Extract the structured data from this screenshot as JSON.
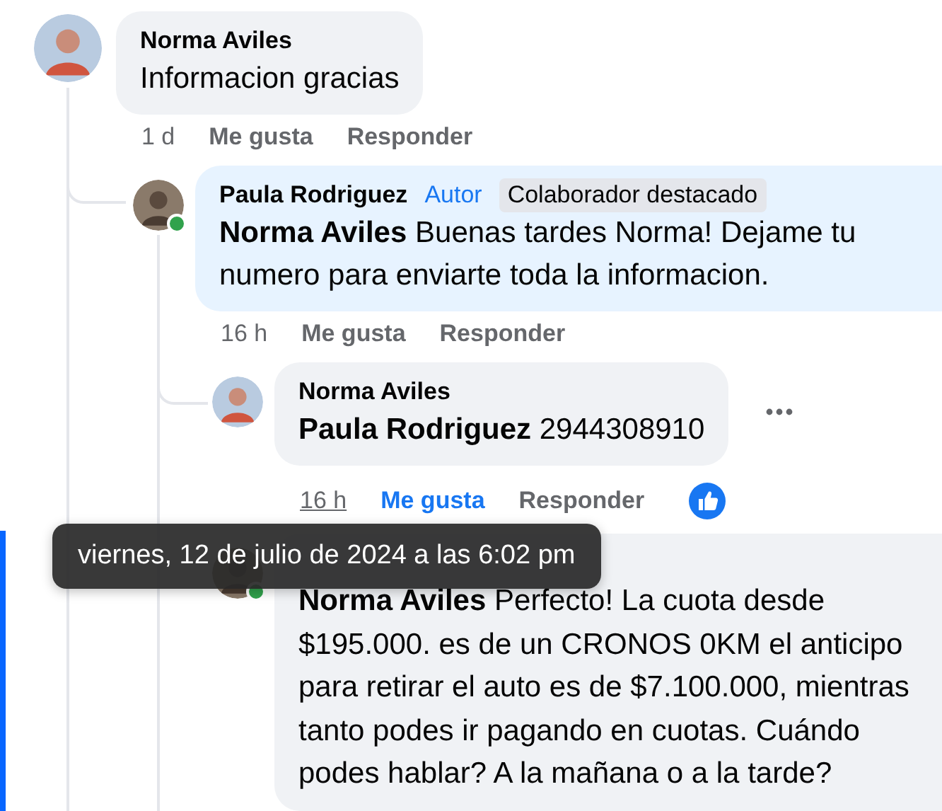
{
  "comments": [
    {
      "author": "Norma Aviles",
      "text": "Informacion gracias",
      "online": false,
      "highlighted": false,
      "time": "1 d",
      "like_label": "Me gusta",
      "reply_label": "Responder",
      "liked": false,
      "hovered": false,
      "reacted": false,
      "children": [
        {
          "author": "Paula Rodriguez",
          "author_badge": "Autor",
          "tag": "Colaborador destacado",
          "mention": "Norma Aviles",
          "text": "Buenas tardes Norma! Dejame tu numero para enviarte toda la informacion.",
          "online": true,
          "highlighted": true,
          "time": "16 h",
          "like_label": "Me gusta",
          "reply_label": "Responder",
          "liked": false,
          "hovered": false,
          "reacted": false,
          "children": [
            {
              "author": "Norma Aviles",
              "mention": "Paula Rodriguez",
              "text": "2944308910",
              "online": false,
              "highlighted": false,
              "options_menu": true,
              "time": "16 h",
              "like_label": "Me gusta",
              "reply_label": "Responder",
              "liked": true,
              "hovered": true,
              "reacted": true
            },
            {
              "mention": "Norma Aviles",
              "text": "Perfecto! La cuota desde $195.000. es de un CRONOS 0KM el anticipo para retirar el auto es de $7.100.000, mientras tanto podes ir pagando en cuotas. Cuándo podes hablar? A la mañana o a la tarde?",
              "online": true,
              "highlighted": false
            }
          ]
        }
      ]
    }
  ],
  "tooltip": {
    "text": "viernes, 12 de julio de 2024 a las 6:02 pm"
  }
}
